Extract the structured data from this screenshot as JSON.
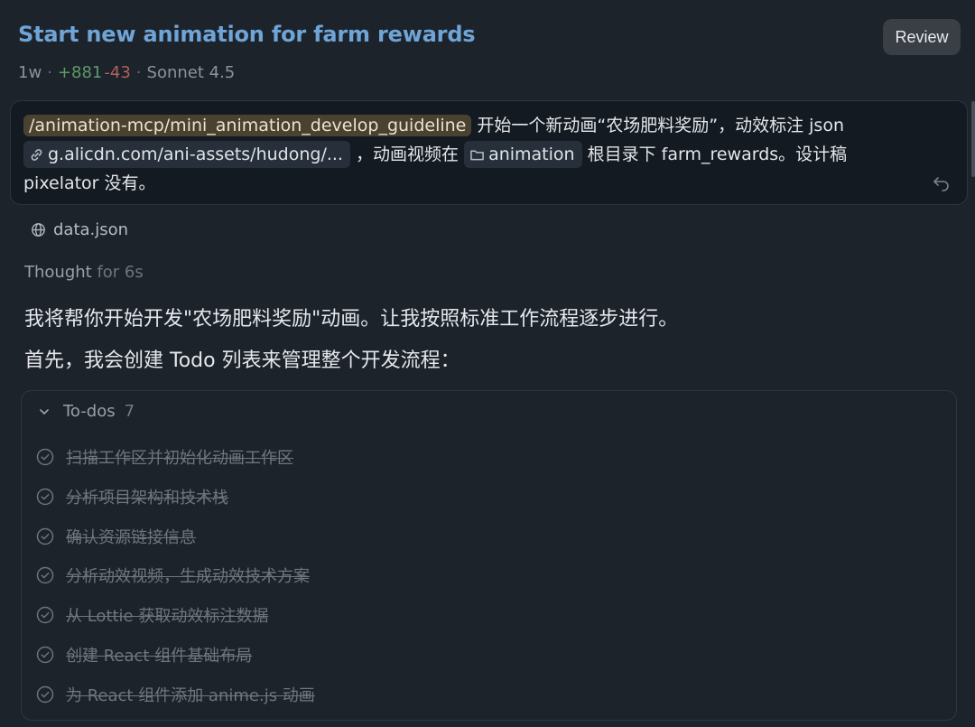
{
  "header": {
    "title": "Start new animation for farm rewards",
    "review_label": "Review",
    "age": "1w",
    "added": "+881",
    "removed": "-43",
    "model": "Sonnet 4.5",
    "separator": "·"
  },
  "prompt": {
    "command": "/animation-mcp/mini_animation_develop_guideline",
    "text1": " 开始一个新动画“农场肥料奖励”，动效标注 json ",
    "link": "g.alicdn.com/ani-assets/hudong/...",
    "text2": " ，动画视频在 ",
    "folder": "animation",
    "text3": " 根目录下 farm_rewards。设计稿 pixelator 没有。"
  },
  "attachment": {
    "name": "data.json"
  },
  "thought": {
    "label": "Thought",
    "duration": "for 6s"
  },
  "message": {
    "line1": "我将帮你开始开发\"农场肥料奖励\"动画。让我按照标准工作流程逐步进行。",
    "line2": "首先，我会创建 Todo 列表来管理整个开发流程："
  },
  "todos": {
    "label": "To-dos",
    "count": "7",
    "items": [
      {
        "label": "扫描工作区并初始化动画工作区",
        "done": true
      },
      {
        "label": "分析项目架构和技术栈",
        "done": true
      },
      {
        "label": "确认资源链接信息",
        "done": true
      },
      {
        "label": "分析动效视频，生成动效技术方案",
        "done": true
      },
      {
        "label": "从 Lottie 获取动效标注数据",
        "done": true
      },
      {
        "label": "创建 React 组件基础布局",
        "done": true
      },
      {
        "label": "为 React 组件添加 anime.js 动画",
        "done": true
      }
    ]
  },
  "colors": {
    "background": "#1d232b",
    "title": "#6fa4d6",
    "added": "#5c9a68",
    "removed": "#b0615c",
    "command_chip": "#4a4231"
  }
}
